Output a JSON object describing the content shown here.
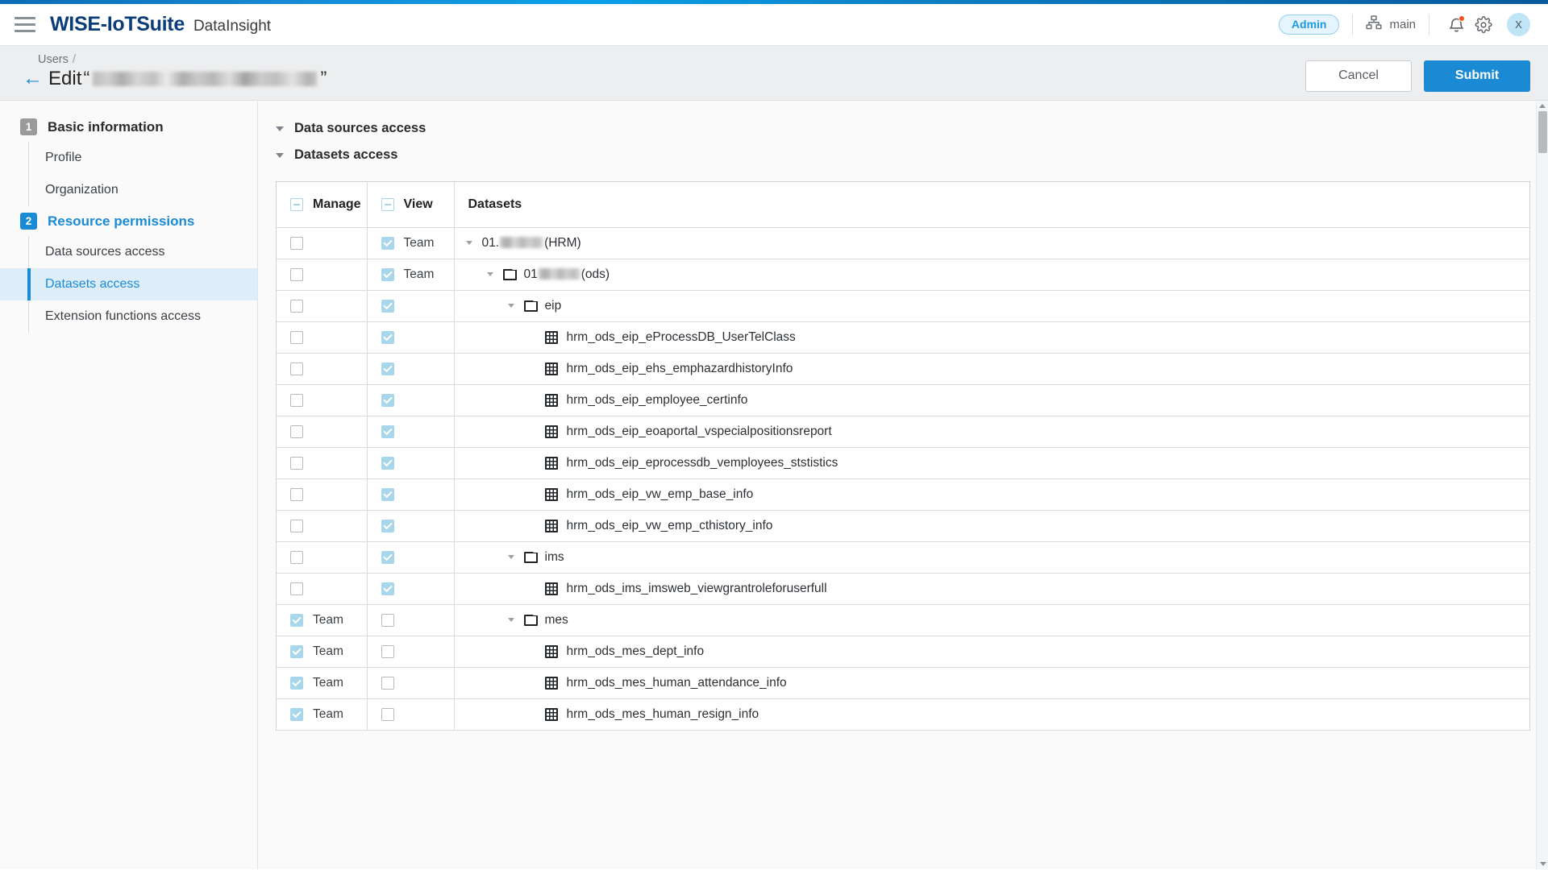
{
  "header": {
    "menu_icon": "hamburger-icon",
    "logo": "WISE-IoTSuite",
    "product": "DataInsight",
    "role_badge": "Admin",
    "org_icon": "org-tree-icon",
    "org_name": "main",
    "notification_icon": "bell-icon",
    "settings_icon": "gear-icon",
    "avatar_initial": "X"
  },
  "titlebar": {
    "breadcrumb_users": "Users",
    "breadcrumb_sep": "/",
    "back_icon": "back-arrow-icon",
    "edit_label": "Edit",
    "quote_open": "“",
    "quote_close": "”",
    "redacted_user": "",
    "cancel_label": "Cancel",
    "submit_label": "Submit"
  },
  "sidebar": {
    "steps": [
      {
        "num": "1",
        "label": "Basic information",
        "active": false,
        "children": [
          {
            "label": "Profile",
            "selected": false
          },
          {
            "label": "Organization",
            "selected": false
          }
        ]
      },
      {
        "num": "2",
        "label": "Resource permissions",
        "active": true,
        "children": [
          {
            "label": "Data sources access",
            "selected": false
          },
          {
            "label": "Datasets access",
            "selected": true
          },
          {
            "label": "Extension functions access",
            "selected": false
          }
        ]
      }
    ]
  },
  "main": {
    "sections": [
      {
        "title": "Data sources access",
        "expanded": true
      },
      {
        "title": "Datasets access",
        "expanded": true
      }
    ],
    "table": {
      "headers": {
        "manage": "Manage",
        "view": "View",
        "datasets": "Datasets"
      },
      "header_manage_state": "indeterminate",
      "header_view_state": "indeterminate",
      "team_label": "Team",
      "rows": [
        {
          "manage": "unchecked",
          "manage_tag": "",
          "view": "checked",
          "view_tag": "Team",
          "indent": 0,
          "expander": true,
          "icon": "none",
          "name_prefix": "01.",
          "redacted": true,
          "redact_w": 54,
          "name_suffix": "(HRM)"
        },
        {
          "manage": "unchecked",
          "manage_tag": "",
          "view": "checked",
          "view_tag": "Team",
          "indent": 1,
          "expander": true,
          "icon": "folder",
          "name_prefix": "01",
          "redacted": true,
          "redact_w": 52,
          "name_suffix": "(ods)"
        },
        {
          "manage": "unchecked",
          "manage_tag": "",
          "view": "checked",
          "view_tag": "",
          "indent": 2,
          "expander": true,
          "icon": "folder",
          "name_prefix": "",
          "redacted": false,
          "redact_w": 0,
          "name_suffix": "eip"
        },
        {
          "manage": "unchecked",
          "manage_tag": "",
          "view": "checked",
          "view_tag": "",
          "indent": 3,
          "expander": false,
          "icon": "grid",
          "name_prefix": "",
          "redacted": false,
          "redact_w": 0,
          "name_suffix": "hrm_ods_eip_eProcessDB_UserTelClass"
        },
        {
          "manage": "unchecked",
          "manage_tag": "",
          "view": "checked",
          "view_tag": "",
          "indent": 3,
          "expander": false,
          "icon": "grid",
          "name_prefix": "",
          "redacted": false,
          "redact_w": 0,
          "name_suffix": "hrm_ods_eip_ehs_emphazardhistoryInfo"
        },
        {
          "manage": "unchecked",
          "manage_tag": "",
          "view": "checked",
          "view_tag": "",
          "indent": 3,
          "expander": false,
          "icon": "grid",
          "name_prefix": "",
          "redacted": false,
          "redact_w": 0,
          "name_suffix": "hrm_ods_eip_employee_certinfo"
        },
        {
          "manage": "unchecked",
          "manage_tag": "",
          "view": "checked",
          "view_tag": "",
          "indent": 3,
          "expander": false,
          "icon": "grid",
          "name_prefix": "",
          "redacted": false,
          "redact_w": 0,
          "name_suffix": "hrm_ods_eip_eoaportal_vspecialpositionsreport"
        },
        {
          "manage": "unchecked",
          "manage_tag": "",
          "view": "checked",
          "view_tag": "",
          "indent": 3,
          "expander": false,
          "icon": "grid",
          "name_prefix": "",
          "redacted": false,
          "redact_w": 0,
          "name_suffix": "hrm_ods_eip_eprocessdb_vemployees_ststistics"
        },
        {
          "manage": "unchecked",
          "manage_tag": "",
          "view": "checked",
          "view_tag": "",
          "indent": 3,
          "expander": false,
          "icon": "grid",
          "name_prefix": "",
          "redacted": false,
          "redact_w": 0,
          "name_suffix": "hrm_ods_eip_vw_emp_base_info"
        },
        {
          "manage": "unchecked",
          "manage_tag": "",
          "view": "checked",
          "view_tag": "",
          "indent": 3,
          "expander": false,
          "icon": "grid",
          "name_prefix": "",
          "redacted": false,
          "redact_w": 0,
          "name_suffix": "hrm_ods_eip_vw_emp_cthistory_info"
        },
        {
          "manage": "unchecked",
          "manage_tag": "",
          "view": "checked",
          "view_tag": "",
          "indent": 2,
          "expander": true,
          "icon": "folder",
          "name_prefix": "",
          "redacted": false,
          "redact_w": 0,
          "name_suffix": "ims"
        },
        {
          "manage": "unchecked",
          "manage_tag": "",
          "view": "checked",
          "view_tag": "",
          "indent": 3,
          "expander": false,
          "icon": "grid",
          "name_prefix": "",
          "redacted": false,
          "redact_w": 0,
          "name_suffix": "hrm_ods_ims_imsweb_viewgrantroleforuserfull"
        },
        {
          "manage": "checked",
          "manage_tag": "Team",
          "view": "unchecked",
          "view_tag": "",
          "indent": 2,
          "expander": true,
          "icon": "folder",
          "name_prefix": "",
          "redacted": false,
          "redact_w": 0,
          "name_suffix": "mes"
        },
        {
          "manage": "checked",
          "manage_tag": "Team",
          "view": "unchecked",
          "view_tag": "",
          "indent": 3,
          "expander": false,
          "icon": "grid",
          "name_prefix": "",
          "redacted": false,
          "redact_w": 0,
          "name_suffix": "hrm_ods_mes_dept_info"
        },
        {
          "manage": "checked",
          "manage_tag": "Team",
          "view": "unchecked",
          "view_tag": "",
          "indent": 3,
          "expander": false,
          "icon": "grid",
          "name_prefix": "",
          "redacted": false,
          "redact_w": 0,
          "name_suffix": "hrm_ods_mes_human_attendance_info"
        },
        {
          "manage": "checked",
          "manage_tag": "Team",
          "view": "unchecked",
          "view_tag": "",
          "indent": 3,
          "expander": false,
          "icon": "grid",
          "name_prefix": "",
          "redacted": false,
          "redact_w": 0,
          "name_suffix": "hrm_ods_mes_human_resign_info"
        }
      ]
    }
  },
  "colors": {
    "accent": "#1a8ad4",
    "brand_dark": "#0a3d7a",
    "checkbox_checked": "#a8d6ea",
    "selected_bg": "#ddedfa",
    "badge_border": "#8fd0f2",
    "notification_dot": "#f4511e"
  }
}
